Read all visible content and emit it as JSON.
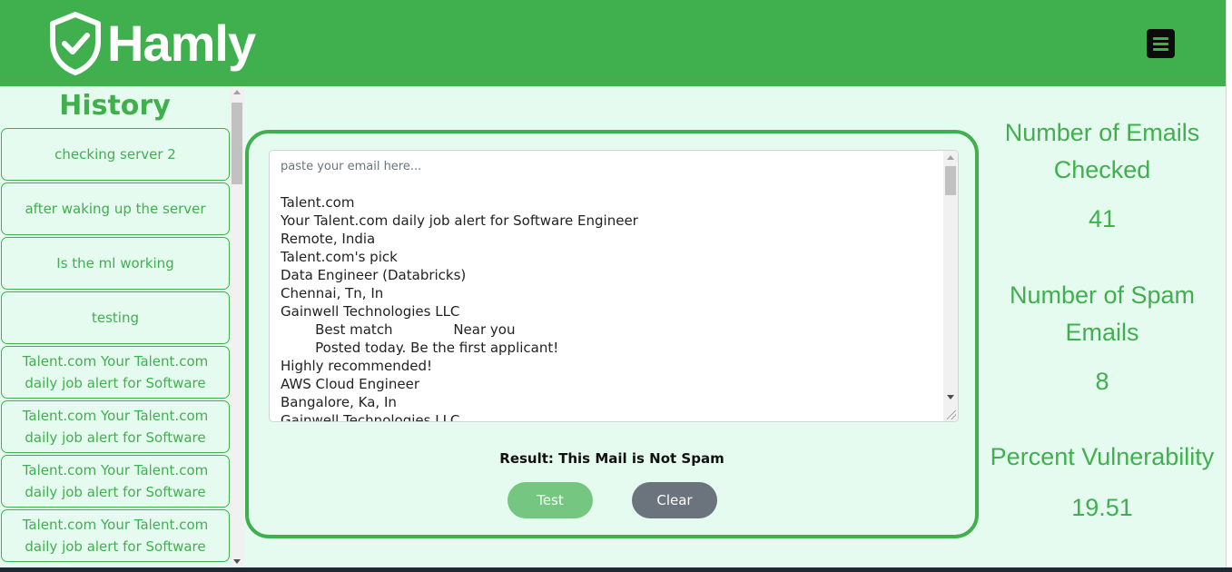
{
  "header": {
    "brand": "Hamly",
    "logo_icon": "shield-check-icon",
    "menu_icon": "hamburger-menu-icon",
    "colors": {
      "primary": "#40b04e",
      "background": "#e6fbef"
    }
  },
  "sidebar": {
    "title": "History",
    "items": [
      {
        "label": "checking server 2"
      },
      {
        "label": "after waking up the server"
      },
      {
        "label": "Is the ml working"
      },
      {
        "label": "testing"
      },
      {
        "label": "Talent.com Your Talent.com daily job alert for Software"
      },
      {
        "label": "Talent.com Your Talent.com daily job alert for Software"
      },
      {
        "label": "Talent.com Your Talent.com daily job alert for Software"
      },
      {
        "label": "Talent.com Your Talent.com daily job alert for Software"
      }
    ]
  },
  "main": {
    "textarea_placeholder": "paste your email here...",
    "textarea_value": "Talent.com\nYour Talent.com daily job alert for Software Engineer\nRemote, India\nTalent.com's pick\nData Engineer (Databricks)\nChennai, Tn, In\nGainwell Technologies LLC\n        Best match              Near you\n        Posted today. Be the first applicant!\nHighly recommended!\nAWS Cloud Engineer\nBangalore, Ka, In\nGainwell Technologies LLC",
    "result": "Result: This Mail is Not Spam",
    "test_label": "Test",
    "clear_label": "Clear"
  },
  "stats": {
    "emails_checked_label": "Number of Emails Checked",
    "emails_checked_value": "41",
    "spam_label": "Number of Spam Emails",
    "spam_value": "8",
    "vulnerability_label": "Percent Vulnerability",
    "vulnerability_value": "19.51"
  }
}
